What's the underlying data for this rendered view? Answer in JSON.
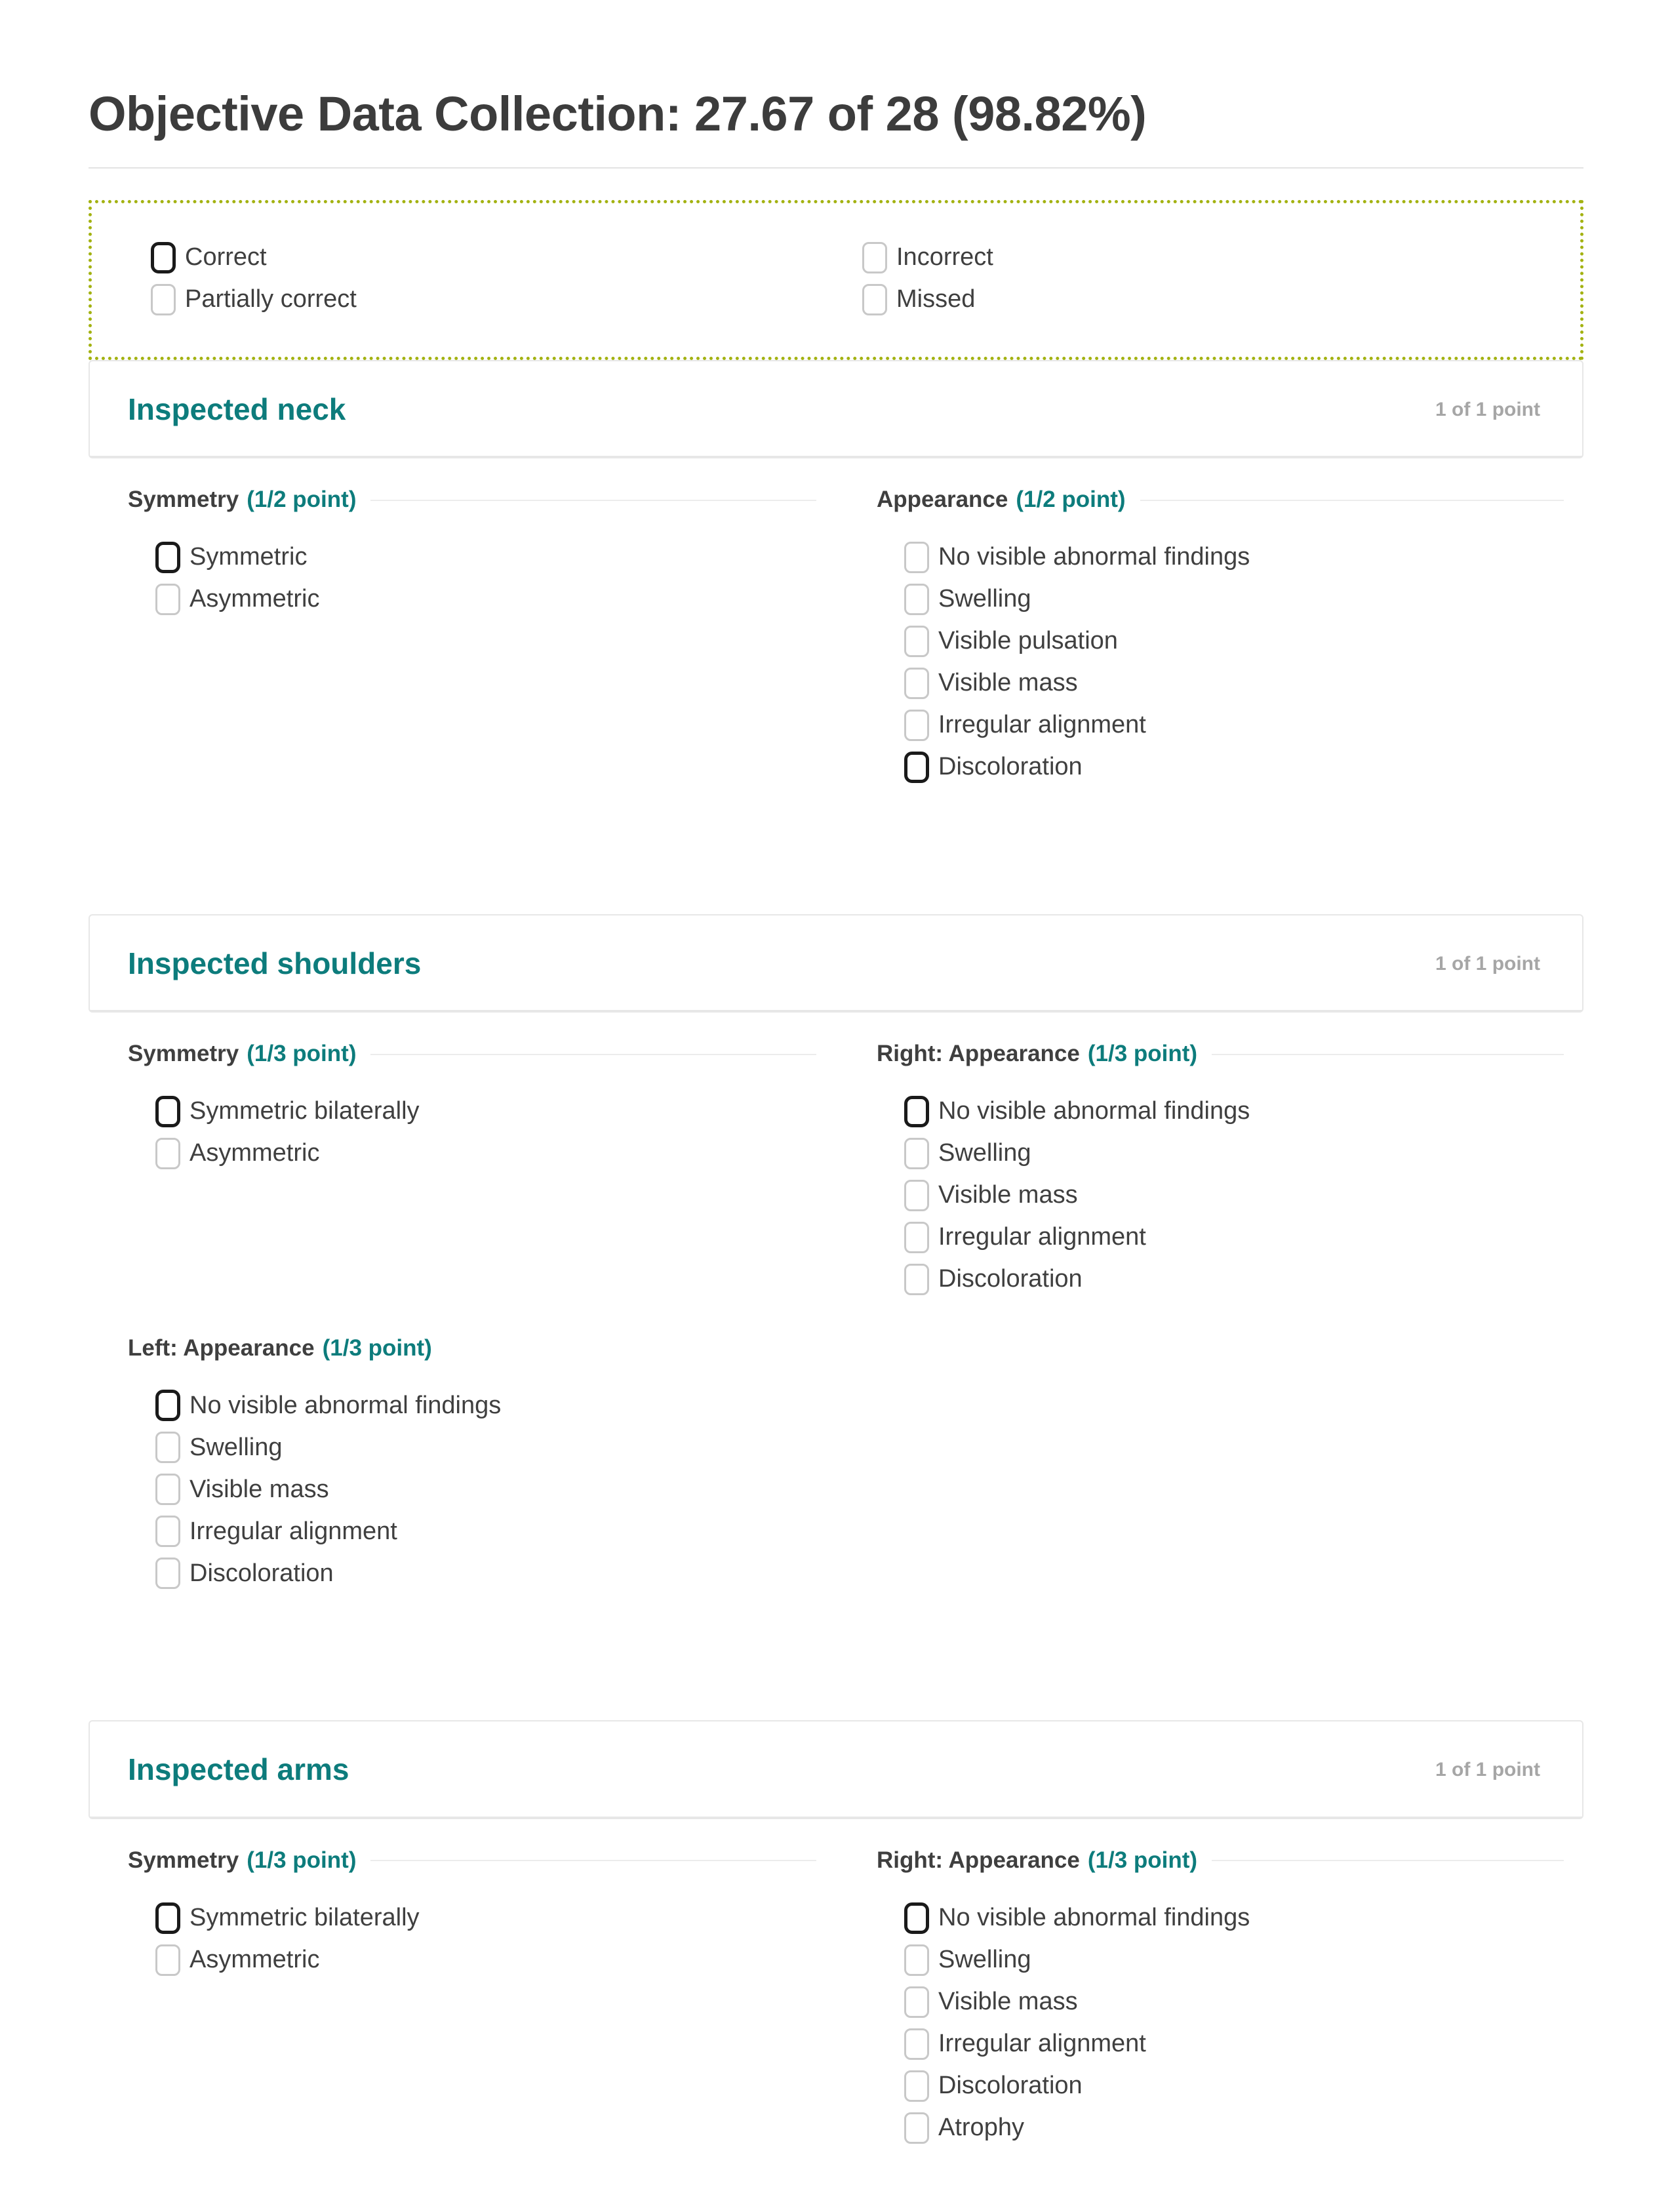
{
  "header": {
    "title": "Objective Data Collection: 27.67 of 28 (98.82%)"
  },
  "legend": {
    "left": [
      {
        "label": "Correct",
        "state": "dark"
      },
      {
        "label": "Partially correct",
        "state": "light"
      }
    ],
    "right": [
      {
        "label": "Incorrect",
        "state": "light"
      },
      {
        "label": "Missed",
        "state": "light"
      }
    ]
  },
  "sections": [
    {
      "name": "Inspected neck",
      "points": "1 of 1 point",
      "left": {
        "heading": "Symmetry",
        "heading_points": "(1/2 point)",
        "rule": true,
        "options": [
          {
            "label": "Symmetric",
            "state": "dark"
          },
          {
            "label": "Asymmetric",
            "state": "light"
          }
        ]
      },
      "right": {
        "heading": "Appearance",
        "heading_points": "(1/2 point)",
        "rule": true,
        "options": [
          {
            "label": "No visible abnormal findings",
            "state": "light"
          },
          {
            "label": "Swelling",
            "state": "light"
          },
          {
            "label": "Visible pulsation",
            "state": "light"
          },
          {
            "label": "Visible mass",
            "state": "light"
          },
          {
            "label": "Irregular alignment",
            "state": "light"
          },
          {
            "label": "Discoloration",
            "state": "dark"
          }
        ]
      },
      "second_left": null
    },
    {
      "name": "Inspected shoulders",
      "points": "1 of 1 point",
      "left": {
        "heading": "Symmetry",
        "heading_points": "(1/3 point)",
        "rule": true,
        "options": [
          {
            "label": "Symmetric bilaterally",
            "state": "dark"
          },
          {
            "label": "Asymmetric",
            "state": "light"
          }
        ]
      },
      "right": {
        "heading": "Right: Appearance",
        "heading_points": "(1/3 point)",
        "rule": true,
        "options": [
          {
            "label": "No visible abnormal findings",
            "state": "dark"
          },
          {
            "label": "Swelling",
            "state": "light"
          },
          {
            "label": "Visible mass",
            "state": "light"
          },
          {
            "label": "Irregular alignment",
            "state": "light"
          },
          {
            "label": "Discoloration",
            "state": "light"
          }
        ]
      },
      "second_left": {
        "heading": "Left: Appearance",
        "heading_points": "(1/3 point)",
        "rule": false,
        "options": [
          {
            "label": "No visible abnormal findings",
            "state": "dark"
          },
          {
            "label": "Swelling",
            "state": "light"
          },
          {
            "label": "Visible mass",
            "state": "light"
          },
          {
            "label": "Irregular alignment",
            "state": "light"
          },
          {
            "label": "Discoloration",
            "state": "light"
          }
        ]
      }
    },
    {
      "name": "Inspected arms",
      "points": "1 of 1 point",
      "left": {
        "heading": "Symmetry",
        "heading_points": "(1/3 point)",
        "rule": true,
        "options": [
          {
            "label": "Symmetric bilaterally",
            "state": "dark"
          },
          {
            "label": "Asymmetric",
            "state": "light"
          }
        ]
      },
      "right": {
        "heading": "Right: Appearance",
        "heading_points": "(1/3 point)",
        "rule": true,
        "options": [
          {
            "label": "No visible abnormal findings",
            "state": "dark"
          },
          {
            "label": "Swelling",
            "state": "light"
          },
          {
            "label": "Visible mass",
            "state": "light"
          },
          {
            "label": "Irregular alignment",
            "state": "light"
          },
          {
            "label": "Discoloration",
            "state": "light"
          },
          {
            "label": "Atrophy",
            "state": "light"
          }
        ]
      },
      "second_left": null
    }
  ],
  "colors": {
    "teal": "#0d7c7c",
    "olive": "#a3b211",
    "text": "#3f3f3f",
    "muted": "#a6a6a6",
    "border": "#e7e7e7"
  }
}
